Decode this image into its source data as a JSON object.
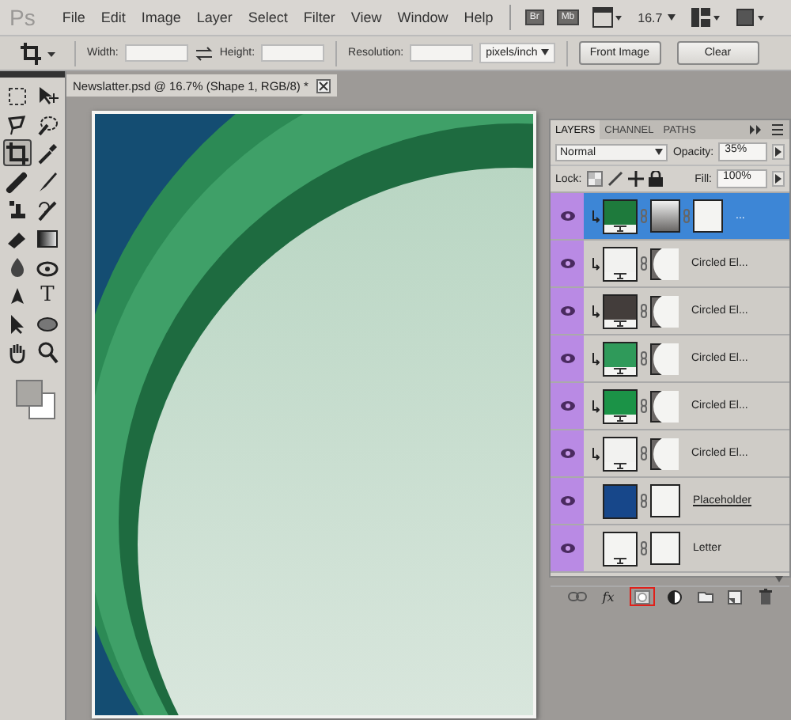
{
  "app_logo": "Ps",
  "menu": [
    "File",
    "Edit",
    "Image",
    "Layer",
    "Select",
    "Filter",
    "View",
    "Window",
    "Help"
  ],
  "app_bar": {
    "bridge": "Br",
    "mini_bridge": "Mb",
    "zoom": "16.7"
  },
  "options_bar": {
    "width_label": "Width:",
    "height_label": "Height:",
    "resolution_label": "Resolution:",
    "unit": "pixels/inch",
    "buttons": [
      "Front Image",
      "Clear"
    ]
  },
  "tools": [
    {
      "selected": false
    },
    {
      "selected": false
    },
    {
      "selected": false
    },
    {
      "selected": false
    },
    {
      "selected": true
    },
    {
      "selected": false
    },
    {
      "selected": false
    },
    {
      "selected": false
    },
    {
      "selected": false
    },
    {
      "selected": false
    },
    {
      "selected": false
    },
    {
      "selected": false
    },
    {
      "selected": false
    },
    {
      "selected": false
    },
    {
      "selected": false
    },
    {
      "selected": false,
      "label": "T"
    },
    {
      "selected": false
    },
    {
      "selected": false
    },
    {
      "selected": false
    },
    {
      "selected": false
    }
  ],
  "swatches": [
    {
      "color": "#a9a7a3"
    },
    {
      "color": "#ffffff"
    }
  ],
  "document_tab": {
    "title": "Newslatter.psd @ 16.7% (Shape 1, RGB/8) *"
  },
  "layers_panel": {
    "tabs": [
      {
        "label": "LAYERS",
        "selected": true
      },
      {
        "label": "CHANNEL",
        "selected": false
      },
      {
        "label": "PATHS",
        "selected": false
      }
    ],
    "blend_mode": "Normal",
    "opacity_label": "Opacity:",
    "opacity": "35%",
    "lock_label": "Lock:",
    "fill_label": "Fill:",
    "fill": "100%",
    "layers": [
      {
        "name": "...",
        "selected": true,
        "visible": true,
        "clipped": true,
        "shape": true,
        "underlined": false,
        "color": "#1e7a3c",
        "masks": [
          {
            "kind": "gradient"
          },
          {
            "kind": "plain"
          }
        ]
      },
      {
        "name": "Circled El...",
        "selected": false,
        "visible": true,
        "clipped": true,
        "shape": true,
        "underlined": false,
        "color": "#f2f2f0",
        "masks": [
          {
            "kind": "circle"
          }
        ]
      },
      {
        "name": "Circled El...",
        "selected": false,
        "visible": true,
        "clipped": true,
        "shape": true,
        "underlined": false,
        "color": "#433d3b",
        "masks": [
          {
            "kind": "circle"
          }
        ]
      },
      {
        "name": "Circled El...",
        "selected": false,
        "visible": true,
        "clipped": true,
        "shape": true,
        "underlined": false,
        "color": "#2f9a5a",
        "masks": [
          {
            "kind": "circle"
          }
        ]
      },
      {
        "name": "Circled El...",
        "selected": false,
        "visible": true,
        "clipped": true,
        "shape": true,
        "underlined": false,
        "color": "#1b9347",
        "masks": [
          {
            "kind": "circle"
          }
        ]
      },
      {
        "name": "Circled El...",
        "selected": false,
        "visible": true,
        "clipped": true,
        "shape": true,
        "underlined": false,
        "color": "#f2f2f0",
        "masks": [
          {
            "kind": "circle"
          }
        ]
      },
      {
        "name": "Placeholder",
        "selected": false,
        "visible": true,
        "clipped": false,
        "shape": false,
        "underlined": true,
        "color": "#17478a",
        "masks": [
          {
            "kind": "plain"
          }
        ]
      },
      {
        "name": "Letter",
        "selected": false,
        "visible": true,
        "clipped": false,
        "shape": true,
        "underlined": false,
        "color": "#f4f4f2",
        "masks": [
          {
            "kind": "plain"
          }
        ]
      }
    ],
    "footer_buttons": [
      {
        "kind": "link",
        "highlighted": false
      },
      {
        "kind": "fx",
        "label": "fx",
        "highlighted": false
      },
      {
        "kind": "mask",
        "highlighted": true
      },
      {
        "kind": "adjustment",
        "highlighted": false
      },
      {
        "kind": "group",
        "highlighted": false
      },
      {
        "kind": "new",
        "highlighted": false
      },
      {
        "kind": "delete",
        "highlighted": false
      }
    ]
  }
}
